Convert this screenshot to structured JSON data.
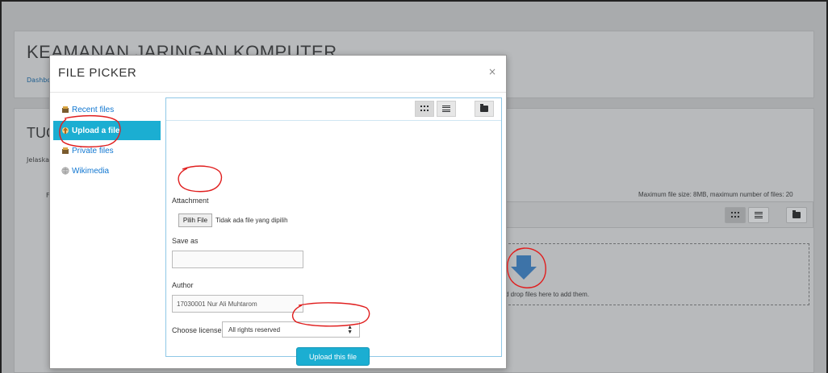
{
  "course": {
    "title": "KEAMANAN JARINGAN KOMPUTER",
    "breadcrumb_start": "Dashbo",
    "section_title_start": "TUC",
    "description_start": "Jelaska",
    "files_label_start": "F"
  },
  "filemanager": {
    "limits_text": "Maximum file size: 8MB, maximum number of files: 20",
    "drop_text": "d drop files here to add them."
  },
  "file_picker": {
    "title": "FILE PICKER",
    "close_label": "×",
    "repositories": [
      {
        "label": "Recent files",
        "icon": "recent-files-icon"
      },
      {
        "label": "Upload a file",
        "icon": "upload-file-icon"
      },
      {
        "label": "Private files",
        "icon": "private-files-icon"
      },
      {
        "label": "Wikimedia",
        "icon": "wikimedia-icon"
      }
    ],
    "form": {
      "attachment_label": "Attachment",
      "choose_file_button": "Pilih File",
      "no_file_text": "Tidak ada file yang dipilih",
      "save_as_label": "Save as",
      "save_as_value": "",
      "author_label": "Author",
      "author_value": "17030001 Nur Ali Muhtarom",
      "license_label": "Choose license",
      "license_value": "All rights reserved",
      "upload_button": "Upload this file"
    }
  },
  "colors": {
    "accent": "#1baed2",
    "link": "#1177d1",
    "annotation": "#e01e1e",
    "overlay": "#a9abad"
  }
}
